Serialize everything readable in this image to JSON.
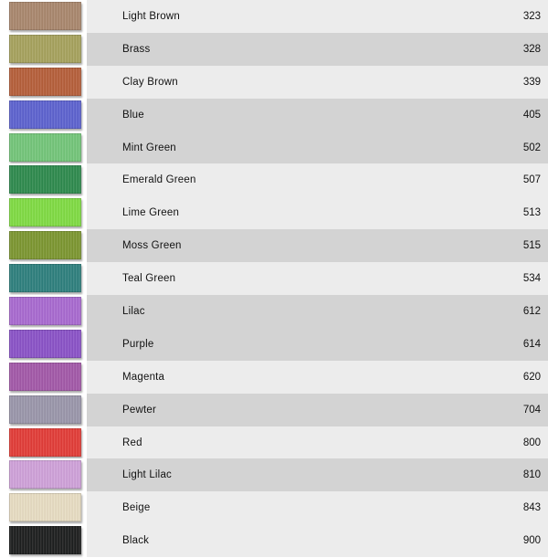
{
  "colors": [
    {
      "name": "Light Brown",
      "code": "323",
      "hex": "#a9876d"
    },
    {
      "name": "Brass",
      "code": "328",
      "hex": "#a6a25d"
    },
    {
      "name": "Clay Brown",
      "code": "339",
      "hex": "#b65e3a"
    },
    {
      "name": "Blue",
      "code": "405",
      "hex": "#5c62cf"
    },
    {
      "name": "Mint Green",
      "code": "502",
      "hex": "#73c579"
    },
    {
      "name": "Emerald Green",
      "code": "507",
      "hex": "#2e8a4d"
    },
    {
      "name": "Lime Green",
      "code": "513",
      "hex": "#7fdb43"
    },
    {
      "name": "Moss Green",
      "code": "515",
      "hex": "#7c9630"
    },
    {
      "name": "Teal Green",
      "code": "534",
      "hex": "#2e7f7d"
    },
    {
      "name": "Lilac",
      "code": "612",
      "hex": "#a86ad0"
    },
    {
      "name": "Purple",
      "code": "614",
      "hex": "#8a52c7"
    },
    {
      "name": "Magenta",
      "code": "620",
      "hex": "#a358a8"
    },
    {
      "name": "Pewter",
      "code": "704",
      "hex": "#9a96aa"
    },
    {
      "name": "Red",
      "code": "800",
      "hex": "#e23c37"
    },
    {
      "name": "Light Lilac",
      "code": "810",
      "hex": "#cfa1d9"
    },
    {
      "name": "Beige",
      "code": "843",
      "hex": "#e7dcc2"
    },
    {
      "name": "Black",
      "code": "900",
      "hex": "#1d1e1e"
    }
  ]
}
